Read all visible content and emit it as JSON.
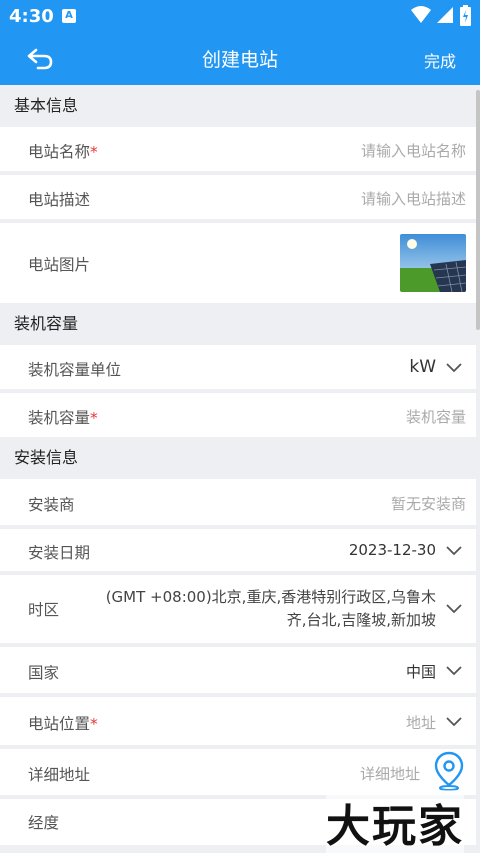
{
  "status_bar": {
    "time": "4:30",
    "notification_badge": "A"
  },
  "header": {
    "title": "创建电站",
    "done_label": "完成",
    "back_icon": "back-arrow-icon"
  },
  "sections": {
    "basic": "基本信息",
    "capacity": "装机容量",
    "install": "安装信息"
  },
  "fields": {
    "name": {
      "label": "电站名称",
      "required": "*",
      "placeholder": "请输入电站名称"
    },
    "desc": {
      "label": "电站描述",
      "placeholder": "请输入电站描述"
    },
    "image": {
      "label": "电站图片"
    },
    "cap_unit": {
      "label": "装机容量单位",
      "value": "kW"
    },
    "capacity": {
      "label": "装机容量",
      "required": "*",
      "placeholder": "装机容量"
    },
    "installer": {
      "label": "安装商",
      "placeholder": "暂无安装商"
    },
    "install_date": {
      "label": "安装日期",
      "value": "2023-12-30"
    },
    "timezone": {
      "label": "时区",
      "value_line1": "(GMT +08:00)北京,重庆,香港特别行政区,乌鲁木",
      "value_line2": "齐,台北,吉隆坡,新加坡"
    },
    "country": {
      "label": "国家",
      "value": "中国"
    },
    "location": {
      "label": "电站位置",
      "required": "*",
      "placeholder": "地址"
    },
    "address": {
      "label": "详细地址",
      "placeholder": "详细地址"
    },
    "longitude": {
      "label": "经度"
    }
  },
  "watermark": "大玩家",
  "colors": {
    "accent": "#2196f3",
    "required": "#e53935"
  }
}
